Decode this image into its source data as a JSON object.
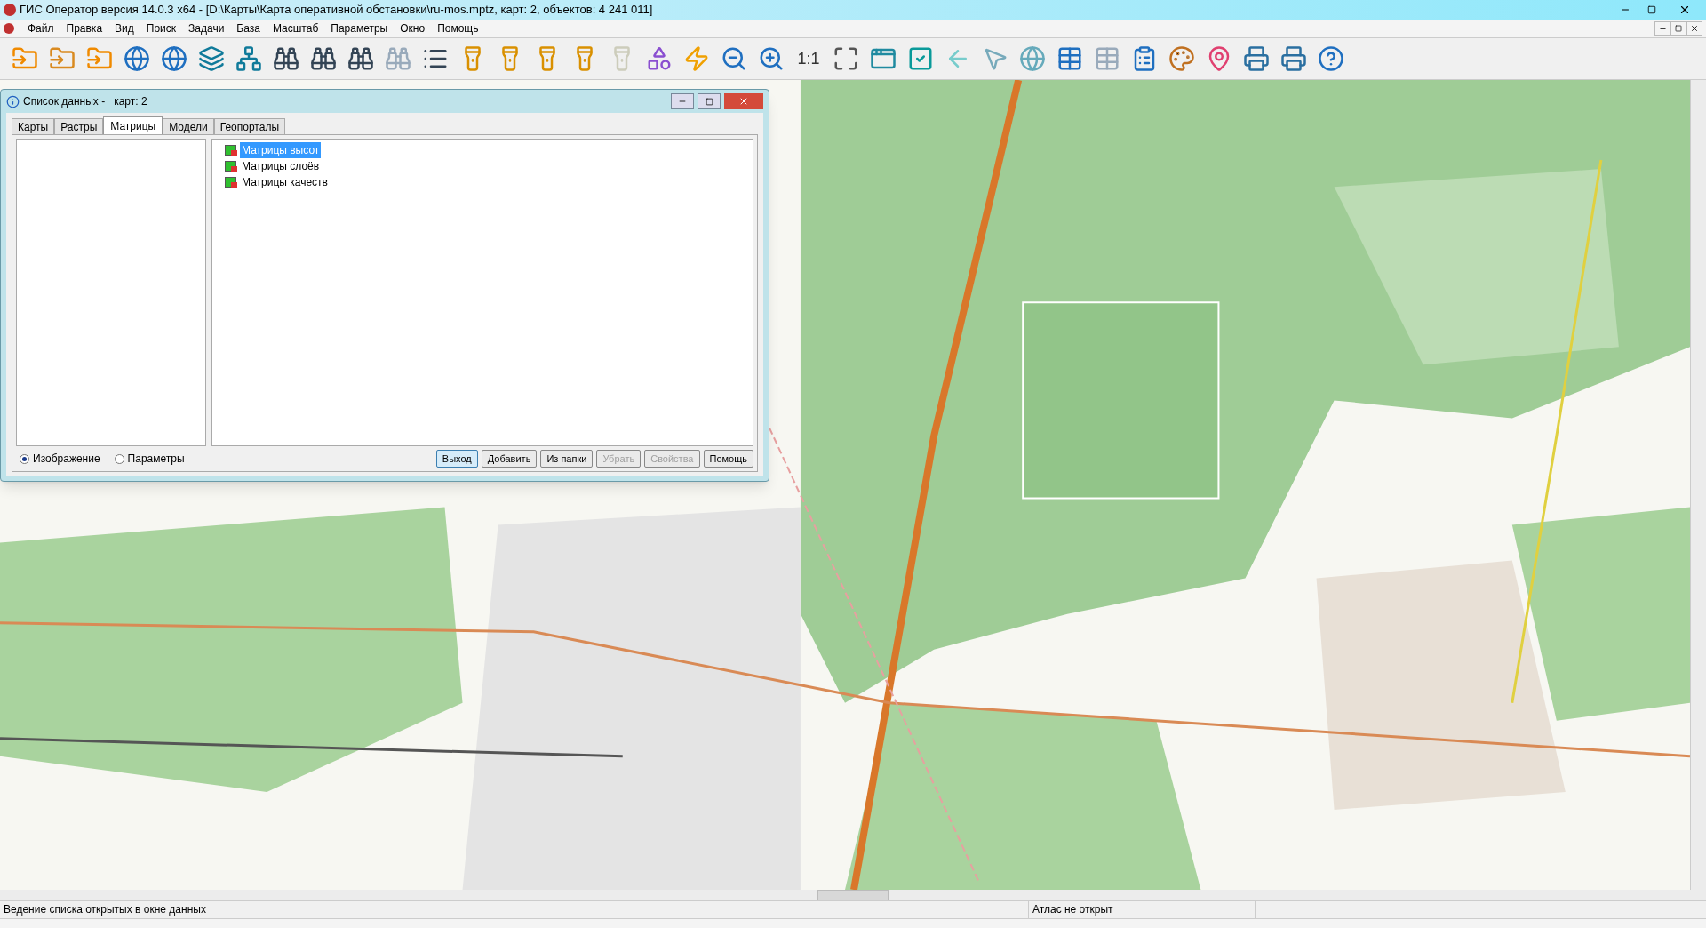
{
  "window": {
    "title": "ГИС Оператор версия 14.0.3 x64 - [D:\\Карты\\Карта оперативной обстановки\\ru-mos.mptz, карт: 2, объектов: 4 241 011]"
  },
  "menu": [
    "Файл",
    "Правка",
    "Вид",
    "Поиск",
    "Задачи",
    "База",
    "Масштаб",
    "Параметры",
    "Окно",
    "Помощь"
  ],
  "toolbar": {
    "scale_label": "1:1"
  },
  "dialog": {
    "title": "Список данных -   карт: 2",
    "tabs": [
      {
        "label": "Карты",
        "selected": false
      },
      {
        "label": "Растры",
        "selected": false
      },
      {
        "label": "Матрицы",
        "selected": true
      },
      {
        "label": "Модели",
        "selected": false
      },
      {
        "label": "Геопорталы",
        "selected": false
      }
    ],
    "tree": [
      {
        "label": "Матрицы высот",
        "selected": true
      },
      {
        "label": "Матрицы слоёв",
        "selected": false
      },
      {
        "label": "Матрицы качеств",
        "selected": false
      }
    ],
    "radios": [
      {
        "label": "Изображение",
        "selected": true
      },
      {
        "label": "Параметры",
        "selected": false
      }
    ],
    "buttons": [
      {
        "label": "Выход",
        "disabled": false,
        "default": true
      },
      {
        "label": "Добавить",
        "disabled": false,
        "default": false
      },
      {
        "label": "Из папки",
        "disabled": false,
        "default": false
      },
      {
        "label": "Убрать",
        "disabled": true,
        "default": false
      },
      {
        "label": "Свойства",
        "disabled": true,
        "default": false
      },
      {
        "label": "Помощь",
        "disabled": false,
        "default": false
      }
    ]
  },
  "status_bar": [
    "Ведение списка открытых в окне данных",
    "Атлас не открыт"
  ]
}
